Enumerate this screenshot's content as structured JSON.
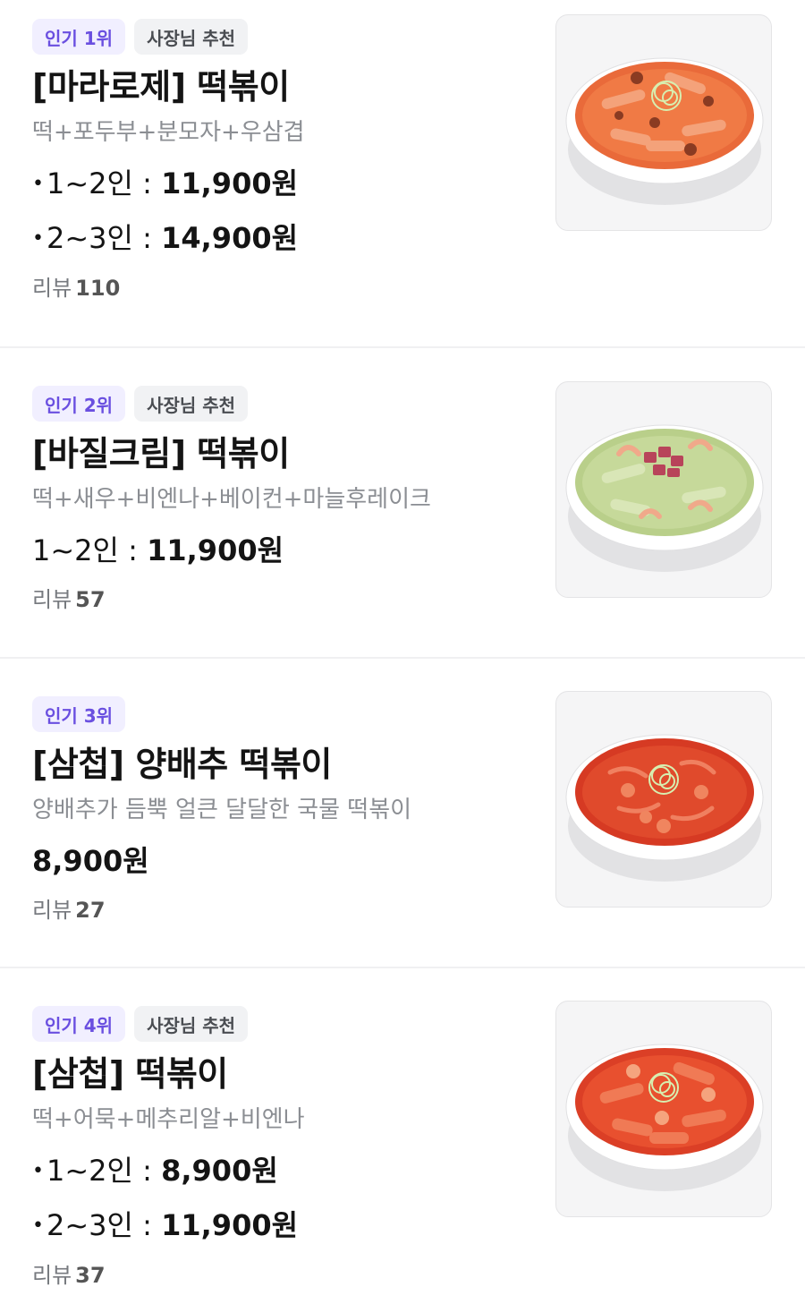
{
  "items": [
    {
      "rank_badge": "인기 1위",
      "owner_badge": "사장님 추천",
      "title": "[마라로제] 떡볶이",
      "desc": "떡+포두부+분모자+우삼겹",
      "prices": [
        {
          "label": "1~2인 : ",
          "amount": "11,900원"
        },
        {
          "label": "2~3인 : ",
          "amount": "14,900원"
        }
      ],
      "review_label": "리뷰",
      "review_count": "110",
      "image_icon": "mala-rose-tteokbokki-bowl-icon"
    },
    {
      "rank_badge": "인기 2위",
      "owner_badge": "사장님 추천",
      "title": "[바질크림] 떡볶이",
      "desc": "떡+새우+비엔나+베이컨+마늘후레이크",
      "prices": [
        {
          "label": "1~2인 : ",
          "amount": "11,900원"
        }
      ],
      "review_label": "리뷰",
      "review_count": "57",
      "image_icon": "basil-cream-tteokbokki-bowl-icon"
    },
    {
      "rank_badge": "인기 3위",
      "title": "[삼첩] 양배추 떡볶이",
      "desc": "양배추가 듬뿍 얼큰 달달한 국물 떡볶이",
      "prices": [
        {
          "amount": "8,900원"
        }
      ],
      "review_label": "리뷰",
      "review_count": "27",
      "image_icon": "cabbage-tteokbokki-bowl-icon"
    },
    {
      "rank_badge": "인기 4위",
      "owner_badge": "사장님 추천",
      "title": "[삼첩] 떡볶이",
      "desc": "떡+어묵+메추리알+비엔나",
      "prices": [
        {
          "label": "1~2인 : ",
          "amount": "8,900원"
        },
        {
          "label": "2~3인 : ",
          "amount": "11,900원"
        }
      ],
      "review_label": "리뷰",
      "review_count": "37",
      "image_icon": "samcheop-tteokbokki-bowl-icon"
    }
  ],
  "colors": {
    "rank_badge_bg": "#f1efff",
    "rank_badge_text": "#6a4fe0",
    "owner_badge_bg": "#f1f2f4",
    "divider": "#f0f0f2"
  }
}
